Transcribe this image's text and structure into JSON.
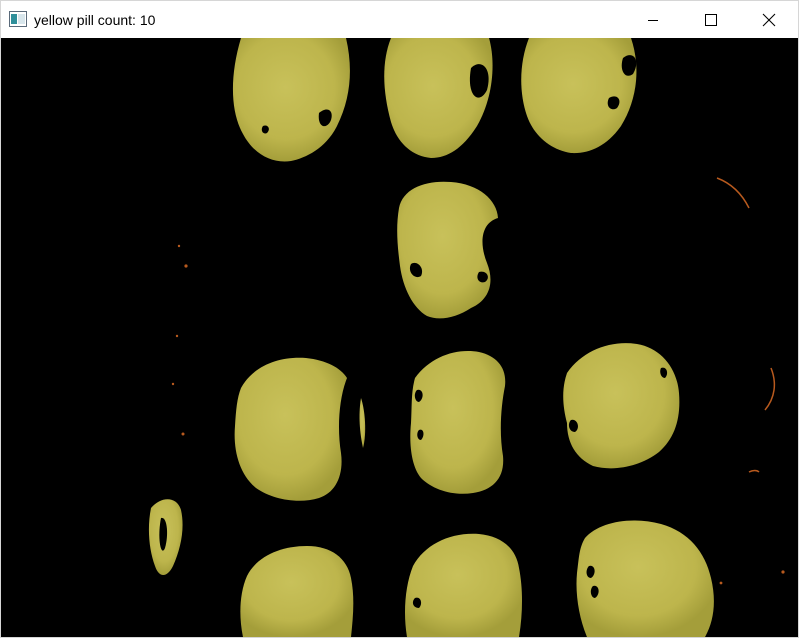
{
  "window": {
    "title": "yellow pill count: 10",
    "app_icon": "window-app-icon",
    "controls": {
      "minimize_icon": "minimize-icon",
      "maximize_icon": "maximize-icon",
      "close_icon": "close-icon"
    }
  },
  "image": {
    "content": "thresholded yellow pills on black background",
    "pill_color": "#c2bb50",
    "pill_shade": "#a9a23c",
    "background_color": "#000000",
    "noise_color": "#b85a1e",
    "pill_count": 10
  }
}
